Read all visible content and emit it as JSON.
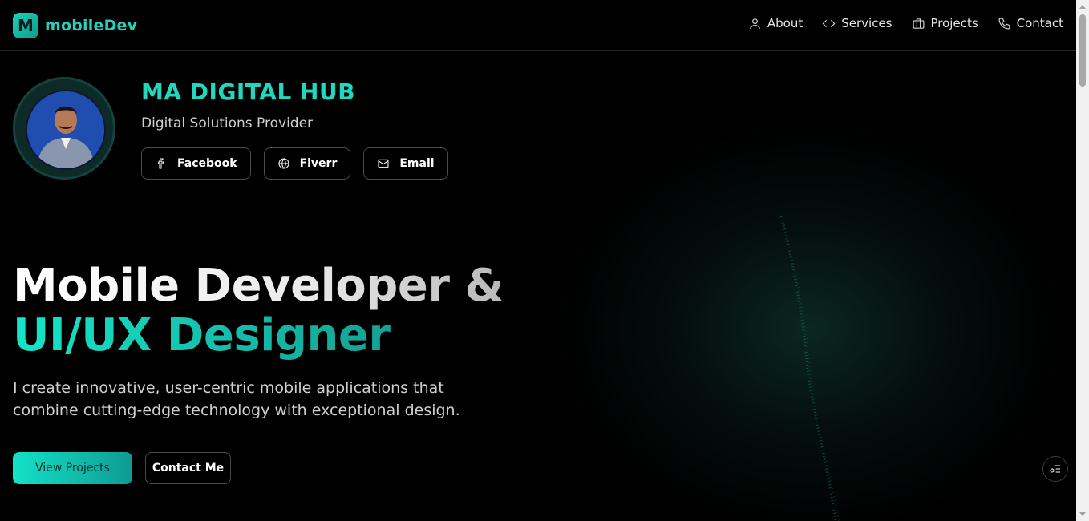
{
  "brand": {
    "badge": "M",
    "name": "mobileDev"
  },
  "nav": {
    "items": [
      {
        "label": "About",
        "icon": "user-icon"
      },
      {
        "label": "Services",
        "icon": "code-icon"
      },
      {
        "label": "Projects",
        "icon": "briefcase-icon"
      },
      {
        "label": "Contact",
        "icon": "phone-icon"
      }
    ]
  },
  "profile": {
    "title": "MA DIGITAL HUB",
    "subtitle": "Digital Solutions Provider",
    "links": [
      {
        "label": "Facebook",
        "icon": "facebook-icon"
      },
      {
        "label": "Fiverr",
        "icon": "globe-icon"
      },
      {
        "label": "Email",
        "icon": "mail-icon"
      }
    ]
  },
  "hero": {
    "heading_line1": "Mobile Developer &",
    "heading_line2": "UI/UX Designer",
    "description": "I create innovative, user-centric mobile applications that combine cutting-edge technology with exceptional design.",
    "primary_cta": "View Projects",
    "secondary_cta": "Contact Me"
  },
  "colors": {
    "accent": "#20d7bf",
    "accent_dark": "#0e9b93",
    "background": "#000000"
  }
}
